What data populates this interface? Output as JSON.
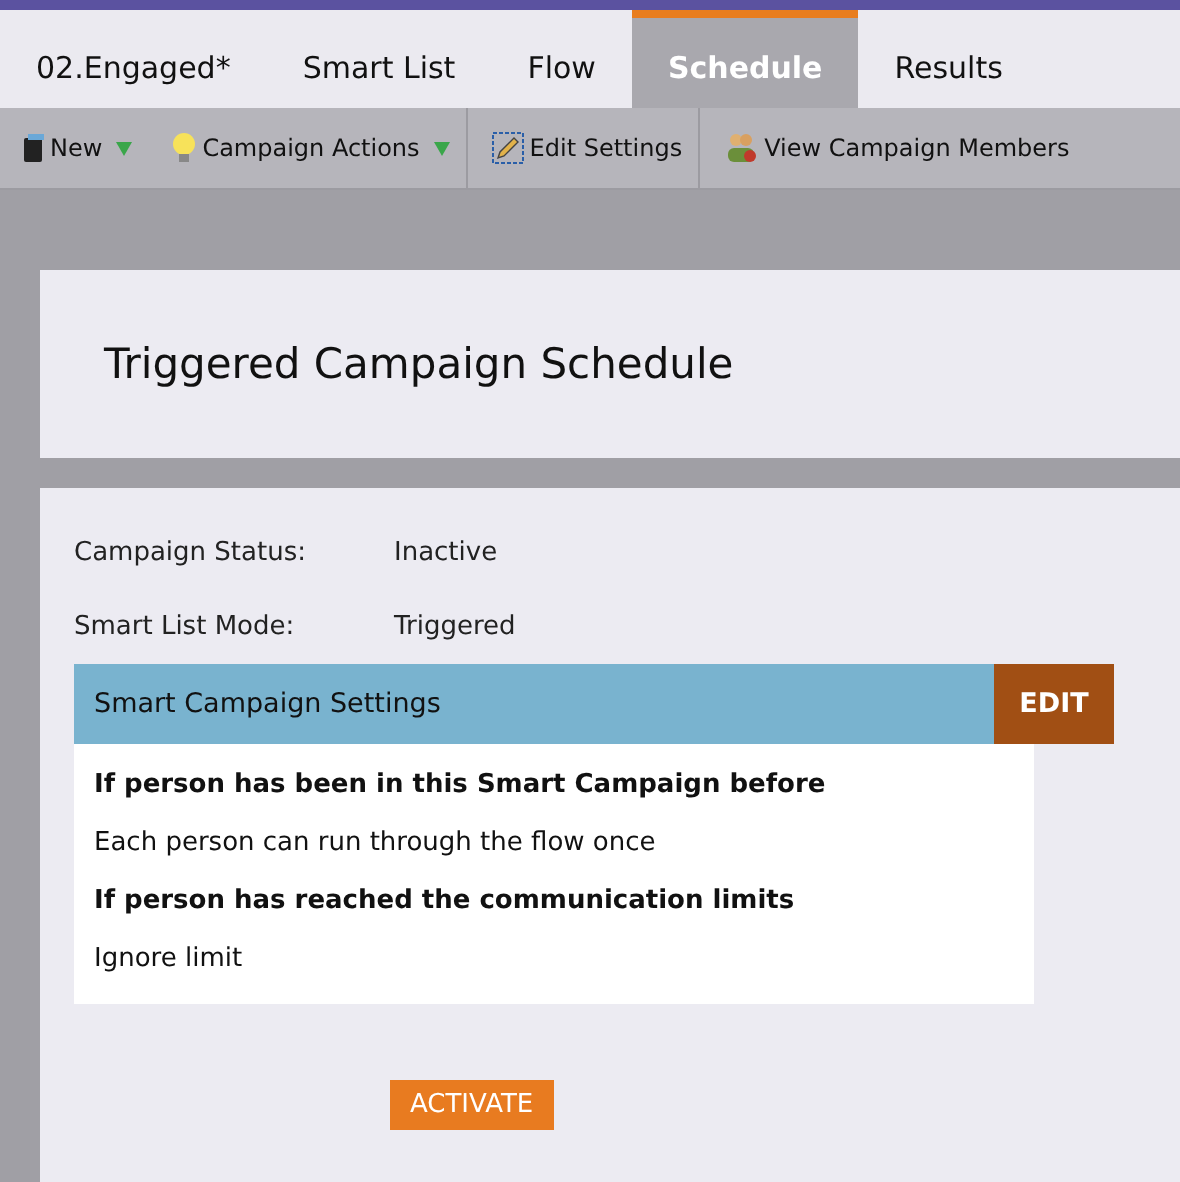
{
  "tabs": [
    {
      "label": "02.Engaged*",
      "selected": false
    },
    {
      "label": "Smart List",
      "selected": false
    },
    {
      "label": "Flow",
      "selected": false
    },
    {
      "label": "Schedule",
      "selected": true
    },
    {
      "label": "Results",
      "selected": false
    }
  ],
  "toolbar": [
    {
      "label": "New",
      "kind": "book",
      "dropdown": true,
      "divider_after": false
    },
    {
      "label": "Campaign Actions",
      "kind": "bulb",
      "dropdown": true,
      "divider_after": true
    },
    {
      "label": "Edit Settings",
      "kind": "pencil",
      "dropdown": false,
      "divider_after": true
    },
    {
      "label": "View Campaign Members",
      "kind": "people",
      "dropdown": false,
      "divider_after": false
    }
  ],
  "page_title": "Triggered Campaign Schedule",
  "fields": [
    {
      "label": "Campaign Status:",
      "value": "Inactive"
    },
    {
      "label": "Smart List Mode:",
      "value": "Triggered"
    }
  ],
  "settings": {
    "title": "Smart Campaign Settings",
    "edit_button": "EDIT",
    "rows": [
      {
        "text": "If person has been in this Smart Campaign before",
        "kind": "heading"
      },
      {
        "text": "Each person can run through the flow once",
        "kind": "value"
      },
      {
        "text": "If person has reached the communication limits",
        "kind": "heading"
      },
      {
        "text": "Ignore limit",
        "kind": "value"
      }
    ]
  },
  "activate_button": "ACTIVATE"
}
